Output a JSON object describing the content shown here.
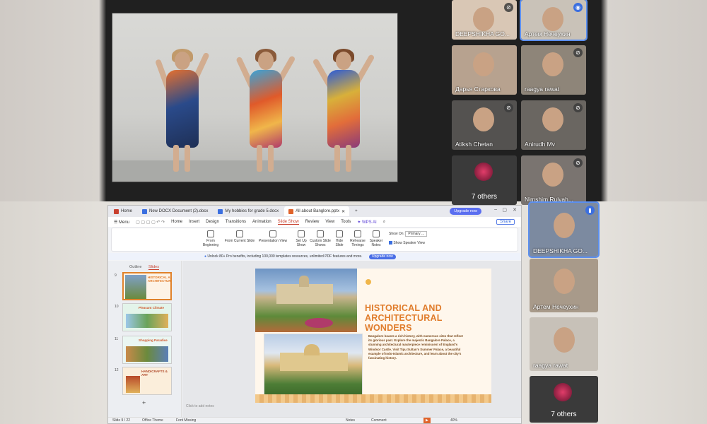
{
  "participants": [
    {
      "name": "DEEPSHIKHA GO...",
      "muted": true,
      "active": false
    },
    {
      "name": "Артем Нечеухин",
      "muted": false,
      "active": true
    },
    {
      "name": "Дарья Старкова",
      "muted": false,
      "active": false
    },
    {
      "name": "raagya rawat",
      "muted": true,
      "active": false
    },
    {
      "name": "Atiksh Chetan",
      "muted": true,
      "active": false
    },
    {
      "name": "Anirudh Mv",
      "muted": true,
      "active": false
    },
    {
      "name": "7 others",
      "muted": false,
      "active": false
    },
    {
      "name": "Nimshim Ruivah...",
      "muted": true,
      "active": false
    }
  ],
  "participants_lower": [
    {
      "name": "DEEPSHIKHA GO...",
      "active": true
    },
    {
      "name": "Артем Нечеухин",
      "active": false
    },
    {
      "name": "raagya rawat",
      "active": false
    },
    {
      "name": "7 others",
      "active": false
    }
  ],
  "wps": {
    "tabs": [
      {
        "label": "Home",
        "icon_color": "#c8402f"
      },
      {
        "label": "New DOCX Document (2).docx",
        "icon_color": "#3b6fe0"
      },
      {
        "label": "My hobbies for grade 5.docx",
        "icon_color": "#3b6fe0"
      },
      {
        "label": "All about Banglore.pptx",
        "icon_color": "#e0632b"
      }
    ],
    "upgrade_label": "Upgrade now",
    "menu": {
      "menu_label": "Menu",
      "items": [
        "Home",
        "Insert",
        "Design",
        "Transitions",
        "Animation",
        "Slide Show",
        "Review",
        "View",
        "Tools"
      ],
      "active": "Slide Show",
      "wps_ai": "WPS AI",
      "share": "Share"
    },
    "ribbon": {
      "from_beginning": "From Beginning",
      "from_current": "From Current Slide",
      "presentation_view": "Presentation View",
      "set_up_show": "Set Up Show",
      "custom_slide_shows": "Custom Slide Shows",
      "hide_slide": "Hide Slide",
      "rehearse_timings": "Rehearse Timings",
      "speaker_notes": "Speaker Notes",
      "show_on_label": "Show On:",
      "show_on_value": "Primary ...",
      "show_speaker_view": "Show Speaker View"
    },
    "notice": {
      "text": "Unlock 80+ Pro benefits, including 100,000 templates resources, unlimited PDF features and more.",
      "button": "Upgrade now"
    },
    "sidepanel": {
      "outline": "Outline",
      "slides": "Slides",
      "thumbs": [
        {
          "num": "9",
          "title": "HISTORICAL AND ARCHITECTURAL",
          "selected": true
        },
        {
          "num": "10",
          "title": "Pleasant Climate",
          "selected": false
        },
        {
          "num": "11",
          "title": "Shopping Paradise",
          "selected": false
        },
        {
          "num": "12",
          "title": "HANDICRAFTS & ART",
          "selected": false
        }
      ]
    },
    "slide": {
      "title": "HISTORICAL AND ARCHITECTURAL WONDERS",
      "body": "Bangalore boasts a rich history, with numerous sites that reflect its glorious past. Explore the majestic Bangalore Palace, a stunning architectural masterpiece reminiscent of England's Windsor Castle. Visit Tipu Sultan's Summer Palace, a beautiful example of Indo-Islamic architecture, and learn about the city's fascinating history.",
      "click_notes": "Click to add notes"
    },
    "status": {
      "slide_count": "Slide 9 / 22",
      "theme": "Office Theme",
      "font_missing": "Font Missing",
      "notes": "Notes",
      "comment": "Comment",
      "zoom": "40%"
    }
  }
}
